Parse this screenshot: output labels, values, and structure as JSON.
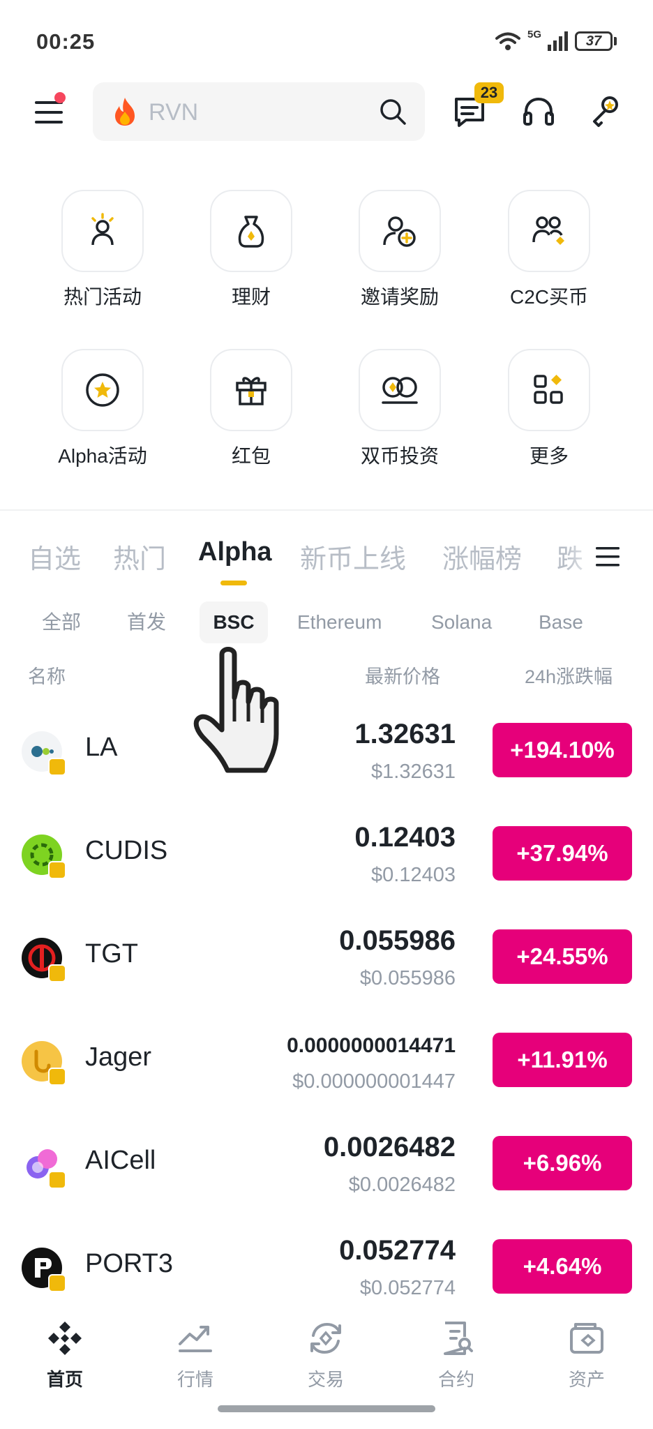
{
  "status_bar": {
    "time": "00:25",
    "network": "5G",
    "battery": "37"
  },
  "top_bar": {
    "search_placeholder": "RVN",
    "messages_badge": "23"
  },
  "quick_actions": [
    {
      "label": "热门活动",
      "icon": "person-sun-icon"
    },
    {
      "label": "理财",
      "icon": "money-bag-icon"
    },
    {
      "label": "邀请奖励",
      "icon": "invite-user-icon"
    },
    {
      "label": "C2C买币",
      "icon": "c2c-users-icon"
    },
    {
      "label": "Alpha活动",
      "icon": "alpha-star-icon"
    },
    {
      "label": "红包",
      "icon": "gift-box-icon"
    },
    {
      "label": "双币投资",
      "icon": "dual-coin-icon"
    },
    {
      "label": "更多",
      "icon": "more-grid-icon"
    }
  ],
  "market_tabs": [
    "自选",
    "热门",
    "Alpha",
    "新币上线",
    "涨幅榜",
    "跌"
  ],
  "active_market_tab": "Alpha",
  "sub_tabs": [
    "全部",
    "首发",
    "BSC",
    "Ethereum",
    "Solana",
    "Base"
  ],
  "active_sub_tab": "BSC",
  "columns": {
    "name": "名称",
    "price": "最新价格",
    "change": "24h涨跌幅"
  },
  "coins": [
    {
      "name": "LA",
      "price": "1.32631",
      "price_usd": "$1.32631",
      "change": "+194.10%"
    },
    {
      "name": "CUDIS",
      "price": "0.12403",
      "price_usd": "$0.12403",
      "change": "+37.94%"
    },
    {
      "name": "TGT",
      "price": "0.055986",
      "price_usd": "$0.055986",
      "change": "+24.55%"
    },
    {
      "name": "Jager",
      "price": "0.0000000014471",
      "price_usd": "$0.000000001447",
      "change": "+11.91%"
    },
    {
      "name": "AICell",
      "price": "0.0026482",
      "price_usd": "$0.0026482",
      "change": "+6.96%"
    },
    {
      "name": "PORT3",
      "price": "0.052774",
      "price_usd": "$0.052774",
      "change": "+4.64%"
    }
  ],
  "bottom_nav": [
    {
      "label": "首页",
      "icon": "binance-home-icon"
    },
    {
      "label": "行情",
      "icon": "markets-chart-icon"
    },
    {
      "label": "交易",
      "icon": "trade-swap-icon"
    },
    {
      "label": "合约",
      "icon": "futures-doc-icon"
    },
    {
      "label": "资产",
      "icon": "wallet-icon"
    }
  ],
  "colors": {
    "accent": "#f0b90b",
    "gain_badge": "#e6007a",
    "text": "#1e2329",
    "muted": "#929aa5"
  }
}
